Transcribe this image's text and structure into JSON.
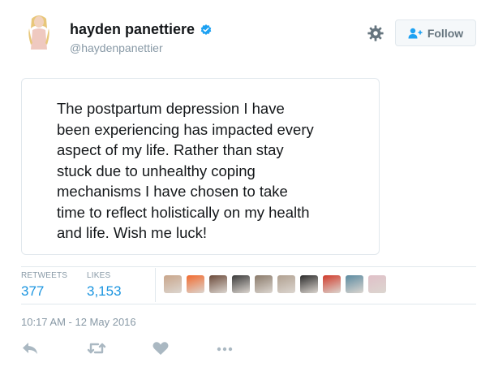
{
  "user": {
    "display_name": "hayden panettiere",
    "screen_name": "@haydenpanettier",
    "verified": true
  },
  "header": {
    "follow_label": "Follow",
    "settings_icon": "gear-icon",
    "follow_icon": "add-user-icon"
  },
  "tweet": {
    "text": "The postpartum depression I have\nbeen experiencing has impacted every\naspect of my life. Rather than stay\nstuck due to unhealthy coping\nmechanisms I have chosen to take\ntime to reflect holistically on my health\nand life. Wish me luck!"
  },
  "stats": {
    "retweets_label": "RETWEETS",
    "retweets_value": "377",
    "likes_label": "LIKES",
    "likes_value": "3,153"
  },
  "likers": [
    "#c9a58a",
    "#f26a2e",
    "#6b4a3a",
    "#3a3a3a",
    "#8a7a6a",
    "#b0a090",
    "#2a2a2a",
    "#d03a2a",
    "#5a8aa0",
    "#e0c0c8"
  ],
  "timestamp": "10:17 AM - 12 May 2016",
  "actions": [
    "reply-icon",
    "retweet-icon",
    "like-icon",
    "more-icon"
  ],
  "colors": {
    "link_blue": "#1b95e0",
    "muted": "#8899a6",
    "border": "#e1e8ed"
  }
}
